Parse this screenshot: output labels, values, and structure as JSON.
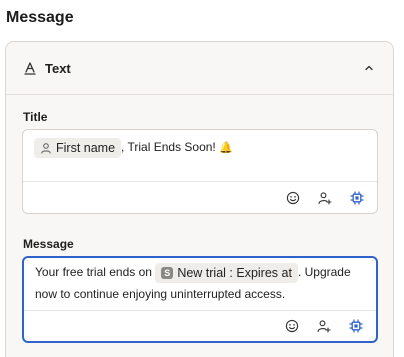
{
  "page": {
    "title": "Message"
  },
  "panel": {
    "header_label": "Text",
    "header_icon": "text-format-icon",
    "collapse_icon": "chevron-up-icon"
  },
  "title_field": {
    "label": "Title",
    "chip_label": "First name",
    "chip_icon": "person-icon",
    "text_after": ", Trial Ends Soon! ",
    "emoji": "🔔"
  },
  "message_field": {
    "label": "Message",
    "text_before": "Your free trial ends on ",
    "chip_badge": "S",
    "chip_label": "New trial : Expires at",
    "text_after": ". Upgrade now to continue enjoying uninterrupted access."
  },
  "toolbar": {
    "emoji_icon": "emoji-icon",
    "personalize_icon": "add-person-icon",
    "ai_icon": "chip-icon"
  },
  "colors": {
    "accent": "#2f63c9",
    "panel_bg": "#f8f7f5",
    "border": "#d7d4cf"
  }
}
